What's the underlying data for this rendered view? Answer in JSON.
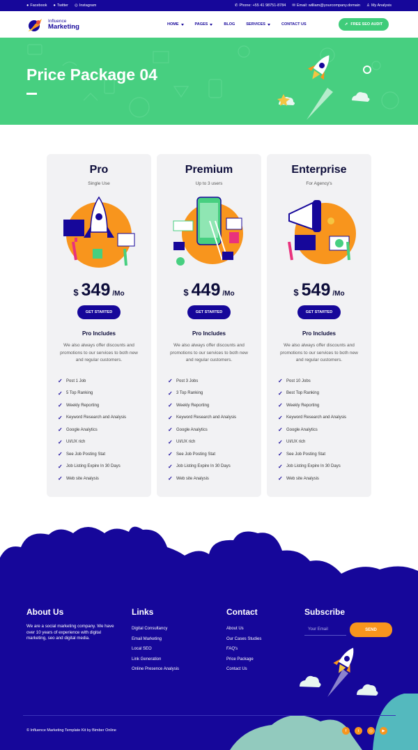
{
  "topbar": {
    "social": [
      {
        "label": "Facebook",
        "icon": "facebook-icon"
      },
      {
        "label": "Twitter",
        "icon": "twitter-icon"
      },
      {
        "label": "Instagram",
        "icon": "instagram-icon"
      }
    ],
    "phone": "Phone: +55 41 98751-8784",
    "email": "Email: william@yourcompany.domain",
    "account": "My Analysis"
  },
  "brand": {
    "line1": "Influence",
    "line2": "Marketing"
  },
  "nav": {
    "items": [
      "HOME",
      "PAGES",
      "BLOG",
      "SERVICES",
      "CONTACT US"
    ],
    "cta": "FREE SEO AUDIT"
  },
  "hero": {
    "title": "Price Package 04"
  },
  "plans": [
    {
      "name": "Pro",
      "usage": "Single Use",
      "currency": "$",
      "price": "349",
      "period": "/Mo",
      "button": "GET STARTED",
      "includes_title": "Pro Includes",
      "description": "We also always offer discounts and promotions to our services to both new and regular customers.",
      "features": [
        "Post 1 Job",
        "5 Top Ranking",
        "Weekly Reporting",
        "Keyword Research and Analysis",
        "Google Analytics",
        "UI/UX rich",
        "See Job Posting Stat",
        "Job Listing Expire In 30 Days",
        "Web site Analysis"
      ]
    },
    {
      "name": "Premium",
      "usage": "Up to 3 users",
      "currency": "$",
      "price": "449",
      "period": "/Mo",
      "button": "GET STARTED",
      "includes_title": "Pro Includes",
      "description": "We also always offer discounts and promotions to our services to both new and regular customers.",
      "features": [
        "Post 3 Jobs",
        "3 Top Ranking",
        "Weekly Reporting",
        "Keyword Research and Analysis",
        "Google Analytics",
        "UI/UX rich",
        "See Job Posting Stat",
        "Job Listing Expire In 30 Days",
        "Web site Analysis"
      ]
    },
    {
      "name": "Enterprise",
      "usage": "For Agency's",
      "currency": "$",
      "price": "549",
      "period": "/Mo",
      "button": "GET STARTED",
      "includes_title": "Pro Includes",
      "description": "We also always offer discounts and promotions to our services to both new and regular customers.",
      "features": [
        "Post 10 Jobs",
        "Best Top Ranking",
        "Weekly Reporting",
        "Keyword Research and Analysis",
        "Google Analytics",
        "UI/UX rich",
        "See Job Posting Stat",
        "Job Listing Expire In 30 Days",
        "Web site Analysis"
      ]
    }
  ],
  "footer": {
    "about_title": "About Us",
    "about_text": "We are a social marketing company. We have over 10 years of experience with digital marketing, seo and digital media.",
    "links_title": "Links",
    "links": [
      "Digital Consultancy",
      "Email Marketing",
      "Local SEO",
      "Link Generation",
      "Online Presence Analysis"
    ],
    "contact_title": "Contact",
    "contact_links": [
      "About Us",
      "Our Cases Studies",
      "FAQ's",
      "Price Package",
      "Contact Us"
    ],
    "subscribe_title": "Subscribe",
    "email_placeholder": "Your Email",
    "send_label": "SEND",
    "copyright": "© Influence Marketing Template Kit by Bimber Online",
    "social_icons": [
      "facebook-icon",
      "twitter-icon",
      "instagram-icon",
      "youtube-icon"
    ]
  },
  "colors": {
    "primary": "#16079a",
    "green": "#47cf80",
    "orange": "#f8951d",
    "card_bg": "#f2f2f4"
  }
}
